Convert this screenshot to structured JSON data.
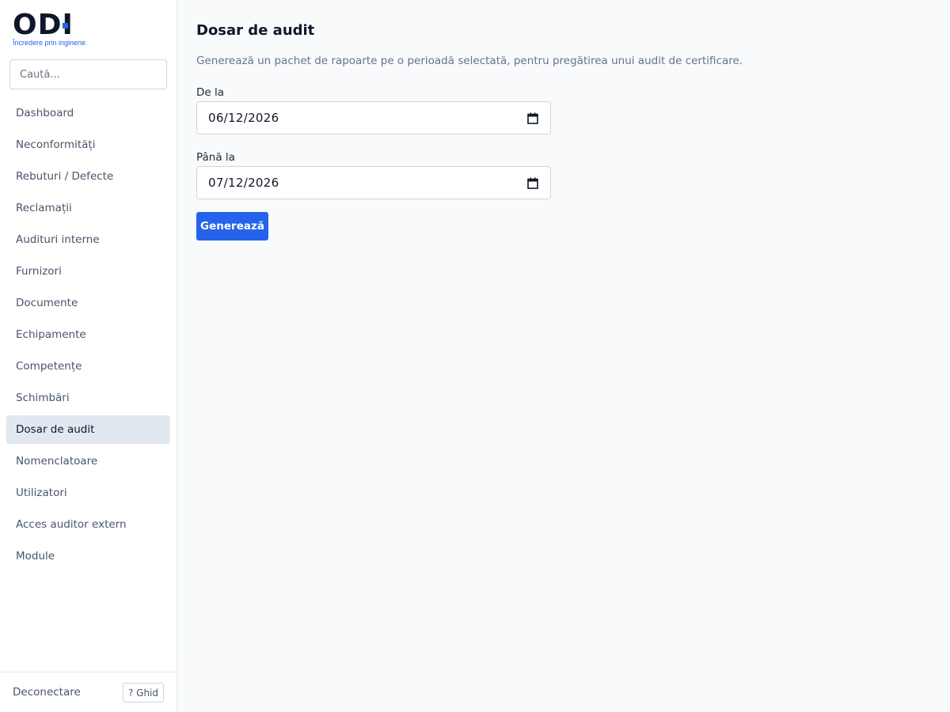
{
  "brand": {
    "name": "ODI",
    "tagline": "Încredere prin inginerie.",
    "accent_color": "#2563eb"
  },
  "sidebar": {
    "search": {
      "placeholder": "Caută..."
    },
    "items": [
      {
        "label": "Dashboard"
      },
      {
        "label": "Neconformități"
      },
      {
        "label": "Rebuturi / Defecte"
      },
      {
        "label": "Reclamații"
      },
      {
        "label": "Audituri interne"
      },
      {
        "label": "Furnizori"
      },
      {
        "label": "Documente"
      },
      {
        "label": "Echipamente"
      },
      {
        "label": "Competențe"
      },
      {
        "label": "Schimbări"
      },
      {
        "label": "Dosar de audit",
        "active": true
      },
      {
        "label": "Nomenclatoare"
      },
      {
        "label": "Utilizatori"
      },
      {
        "label": "Acces auditor extern"
      },
      {
        "label": "Module"
      }
    ],
    "footer": {
      "logout_label": "Deconectare",
      "guide_label": "? Ghid"
    }
  },
  "main": {
    "title": "Dosar de audit",
    "description": "Generează un pachet de rapoarte pe o perioadă selectată, pentru pregătirea unui audit de certificare.",
    "from": {
      "label": "De la",
      "value": "06/12/2026",
      "icon": "calendar-icon"
    },
    "to": {
      "label": "Până la",
      "value": "07/12/2026",
      "icon": "calendar-icon"
    },
    "generate_label": "Generează"
  }
}
